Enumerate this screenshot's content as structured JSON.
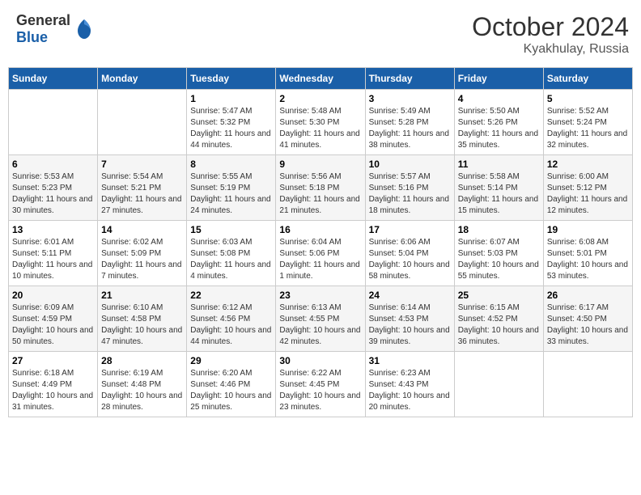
{
  "header": {
    "logo_general": "General",
    "logo_blue": "Blue",
    "title": "October 2024",
    "subtitle": "Kyakhulay, Russia"
  },
  "weekdays": [
    "Sunday",
    "Monday",
    "Tuesday",
    "Wednesday",
    "Thursday",
    "Friday",
    "Saturday"
  ],
  "weeks": [
    [
      {
        "day": "",
        "sunrise": "",
        "sunset": "",
        "daylight": ""
      },
      {
        "day": "",
        "sunrise": "",
        "sunset": "",
        "daylight": ""
      },
      {
        "day": "1",
        "sunrise": "Sunrise: 5:47 AM",
        "sunset": "Sunset: 5:32 PM",
        "daylight": "Daylight: 11 hours and 44 minutes."
      },
      {
        "day": "2",
        "sunrise": "Sunrise: 5:48 AM",
        "sunset": "Sunset: 5:30 PM",
        "daylight": "Daylight: 11 hours and 41 minutes."
      },
      {
        "day": "3",
        "sunrise": "Sunrise: 5:49 AM",
        "sunset": "Sunset: 5:28 PM",
        "daylight": "Daylight: 11 hours and 38 minutes."
      },
      {
        "day": "4",
        "sunrise": "Sunrise: 5:50 AM",
        "sunset": "Sunset: 5:26 PM",
        "daylight": "Daylight: 11 hours and 35 minutes."
      },
      {
        "day": "5",
        "sunrise": "Sunrise: 5:52 AM",
        "sunset": "Sunset: 5:24 PM",
        "daylight": "Daylight: 11 hours and 32 minutes."
      }
    ],
    [
      {
        "day": "6",
        "sunrise": "Sunrise: 5:53 AM",
        "sunset": "Sunset: 5:23 PM",
        "daylight": "Daylight: 11 hours and 30 minutes."
      },
      {
        "day": "7",
        "sunrise": "Sunrise: 5:54 AM",
        "sunset": "Sunset: 5:21 PM",
        "daylight": "Daylight: 11 hours and 27 minutes."
      },
      {
        "day": "8",
        "sunrise": "Sunrise: 5:55 AM",
        "sunset": "Sunset: 5:19 PM",
        "daylight": "Daylight: 11 hours and 24 minutes."
      },
      {
        "day": "9",
        "sunrise": "Sunrise: 5:56 AM",
        "sunset": "Sunset: 5:18 PM",
        "daylight": "Daylight: 11 hours and 21 minutes."
      },
      {
        "day": "10",
        "sunrise": "Sunrise: 5:57 AM",
        "sunset": "Sunset: 5:16 PM",
        "daylight": "Daylight: 11 hours and 18 minutes."
      },
      {
        "day": "11",
        "sunrise": "Sunrise: 5:58 AM",
        "sunset": "Sunset: 5:14 PM",
        "daylight": "Daylight: 11 hours and 15 minutes."
      },
      {
        "day": "12",
        "sunrise": "Sunrise: 6:00 AM",
        "sunset": "Sunset: 5:12 PM",
        "daylight": "Daylight: 11 hours and 12 minutes."
      }
    ],
    [
      {
        "day": "13",
        "sunrise": "Sunrise: 6:01 AM",
        "sunset": "Sunset: 5:11 PM",
        "daylight": "Daylight: 11 hours and 10 minutes."
      },
      {
        "day": "14",
        "sunrise": "Sunrise: 6:02 AM",
        "sunset": "Sunset: 5:09 PM",
        "daylight": "Daylight: 11 hours and 7 minutes."
      },
      {
        "day": "15",
        "sunrise": "Sunrise: 6:03 AM",
        "sunset": "Sunset: 5:08 PM",
        "daylight": "Daylight: 11 hours and 4 minutes."
      },
      {
        "day": "16",
        "sunrise": "Sunrise: 6:04 AM",
        "sunset": "Sunset: 5:06 PM",
        "daylight": "Daylight: 11 hours and 1 minute."
      },
      {
        "day": "17",
        "sunrise": "Sunrise: 6:06 AM",
        "sunset": "Sunset: 5:04 PM",
        "daylight": "Daylight: 10 hours and 58 minutes."
      },
      {
        "day": "18",
        "sunrise": "Sunrise: 6:07 AM",
        "sunset": "Sunset: 5:03 PM",
        "daylight": "Daylight: 10 hours and 55 minutes."
      },
      {
        "day": "19",
        "sunrise": "Sunrise: 6:08 AM",
        "sunset": "Sunset: 5:01 PM",
        "daylight": "Daylight: 10 hours and 53 minutes."
      }
    ],
    [
      {
        "day": "20",
        "sunrise": "Sunrise: 6:09 AM",
        "sunset": "Sunset: 4:59 PM",
        "daylight": "Daylight: 10 hours and 50 minutes."
      },
      {
        "day": "21",
        "sunrise": "Sunrise: 6:10 AM",
        "sunset": "Sunset: 4:58 PM",
        "daylight": "Daylight: 10 hours and 47 minutes."
      },
      {
        "day": "22",
        "sunrise": "Sunrise: 6:12 AM",
        "sunset": "Sunset: 4:56 PM",
        "daylight": "Daylight: 10 hours and 44 minutes."
      },
      {
        "day": "23",
        "sunrise": "Sunrise: 6:13 AM",
        "sunset": "Sunset: 4:55 PM",
        "daylight": "Daylight: 10 hours and 42 minutes."
      },
      {
        "day": "24",
        "sunrise": "Sunrise: 6:14 AM",
        "sunset": "Sunset: 4:53 PM",
        "daylight": "Daylight: 10 hours and 39 minutes."
      },
      {
        "day": "25",
        "sunrise": "Sunrise: 6:15 AM",
        "sunset": "Sunset: 4:52 PM",
        "daylight": "Daylight: 10 hours and 36 minutes."
      },
      {
        "day": "26",
        "sunrise": "Sunrise: 6:17 AM",
        "sunset": "Sunset: 4:50 PM",
        "daylight": "Daylight: 10 hours and 33 minutes."
      }
    ],
    [
      {
        "day": "27",
        "sunrise": "Sunrise: 6:18 AM",
        "sunset": "Sunset: 4:49 PM",
        "daylight": "Daylight: 10 hours and 31 minutes."
      },
      {
        "day": "28",
        "sunrise": "Sunrise: 6:19 AM",
        "sunset": "Sunset: 4:48 PM",
        "daylight": "Daylight: 10 hours and 28 minutes."
      },
      {
        "day": "29",
        "sunrise": "Sunrise: 6:20 AM",
        "sunset": "Sunset: 4:46 PM",
        "daylight": "Daylight: 10 hours and 25 minutes."
      },
      {
        "day": "30",
        "sunrise": "Sunrise: 6:22 AM",
        "sunset": "Sunset: 4:45 PM",
        "daylight": "Daylight: 10 hours and 23 minutes."
      },
      {
        "day": "31",
        "sunrise": "Sunrise: 6:23 AM",
        "sunset": "Sunset: 4:43 PM",
        "daylight": "Daylight: 10 hours and 20 minutes."
      },
      {
        "day": "",
        "sunrise": "",
        "sunset": "",
        "daylight": ""
      },
      {
        "day": "",
        "sunrise": "",
        "sunset": "",
        "daylight": ""
      }
    ]
  ]
}
